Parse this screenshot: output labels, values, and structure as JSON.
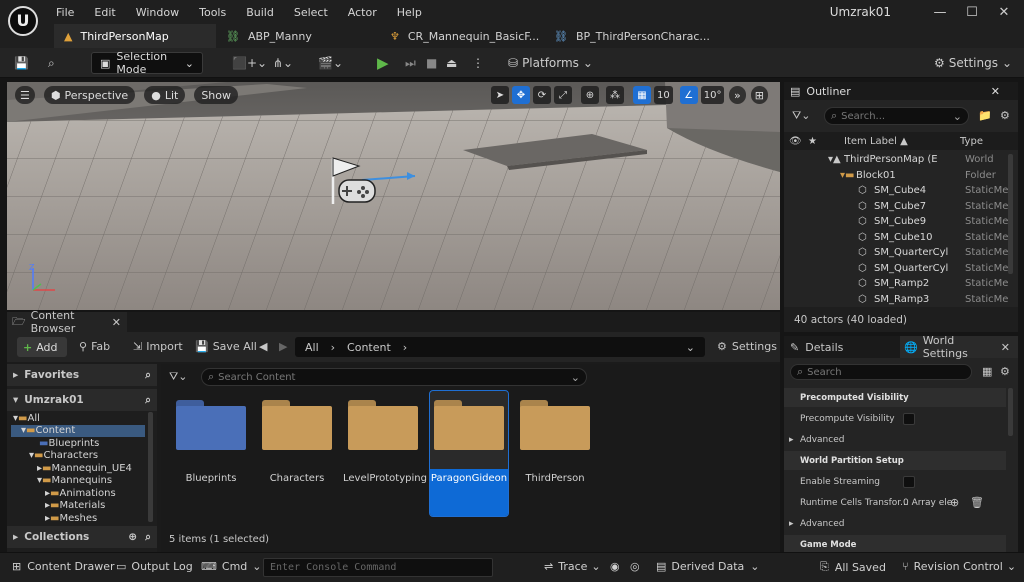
{
  "menu": [
    "File",
    "Edit",
    "Window",
    "Tools",
    "Build",
    "Select",
    "Actor",
    "Help"
  ],
  "window": {
    "title": "Umzrak01"
  },
  "tabs": [
    {
      "label": "ThirdPersonMap",
      "active": true
    },
    {
      "label": "ABP_Manny",
      "active": false
    },
    {
      "label": "CR_Mannequin_BasicF...",
      "active": false
    },
    {
      "label": "BP_ThirdPersonCharac...",
      "active": false
    }
  ],
  "toolbar": {
    "selection_mode": "Selection Mode",
    "platforms": "Platforms",
    "settings": "Settings"
  },
  "viewport": {
    "perspective": "Perspective",
    "lit": "Lit",
    "show": "Show",
    "grid_size": "10",
    "angle": "10°"
  },
  "outliner": {
    "title": "Outliner",
    "search_placeholder": "Search...",
    "col_label": "Item Label ▲",
    "col_type": "Type",
    "rows": [
      {
        "label": "ThirdPersonMap (E",
        "type": "World"
      },
      {
        "label": "Block01",
        "type": "Folder"
      },
      {
        "label": "SM_Cube4",
        "type": "StaticMe"
      },
      {
        "label": "SM_Cube7",
        "type": "StaticMe"
      },
      {
        "label": "SM_Cube9",
        "type": "StaticMe"
      },
      {
        "label": "SM_Cube10",
        "type": "StaticMe"
      },
      {
        "label": "SM_QuarterCyl",
        "type": "StaticMe"
      },
      {
        "label": "SM_QuarterCyl",
        "type": "StaticMe"
      },
      {
        "label": "SM_Ramp2",
        "type": "StaticMe"
      },
      {
        "label": "SM_Ramp3",
        "type": "StaticMe"
      }
    ],
    "footer": "40 actors (40 loaded)"
  },
  "content_browser": {
    "title": "Content Browser",
    "add": "Add",
    "fab": "Fab",
    "import": "Import",
    "save_all": "Save All",
    "path": [
      "All",
      "Content"
    ],
    "settings": "Settings",
    "favorites": "Favorites",
    "project": "Umzrak01",
    "collections": "Collections",
    "search_placeholder": "Search Content",
    "tree": [
      "All",
      "Content",
      "Blueprints",
      "Characters",
      "Mannequin_UE4",
      "Mannequins",
      "Animations",
      "Materials",
      "Meshes"
    ],
    "folders": [
      {
        "name": "Blueprints",
        "color": "#4a6fb8"
      },
      {
        "name": "Characters",
        "color": "#c89b5a"
      },
      {
        "name": "LevelPrototyping",
        "color": "#c89b5a"
      },
      {
        "name": "ParagonGideon",
        "color": "#c89b5a",
        "selected": true
      },
      {
        "name": "ThirdPerson",
        "color": "#c89b5a"
      }
    ],
    "footer": "5 items (1 selected)"
  },
  "details": {
    "tab_details": "Details",
    "tab_world": "World Settings",
    "search_placeholder": "Search",
    "rows": [
      {
        "kind": "section",
        "label": "Precomputed Visibility"
      },
      {
        "kind": "prop",
        "label": "Precompute Visibility"
      },
      {
        "kind": "collapsed",
        "label": "Advanced"
      },
      {
        "kind": "section",
        "label": "World Partition Setup"
      },
      {
        "kind": "prop",
        "label": "Enable Streaming"
      },
      {
        "kind": "prop",
        "label": "Runtime Cells Transfor...",
        "value": "0 Array ele"
      },
      {
        "kind": "collapsed",
        "label": "Advanced"
      },
      {
        "kind": "section",
        "label": "Game Mode"
      }
    ]
  },
  "statusbar": {
    "content_drawer": "Content Drawer",
    "output_log": "Output Log",
    "cmd": "Cmd",
    "console_placeholder": "Enter Console Command",
    "trace": "Trace",
    "derived_data": "Derived Data",
    "all_saved": "All Saved",
    "revision_control": "Revision Control"
  }
}
